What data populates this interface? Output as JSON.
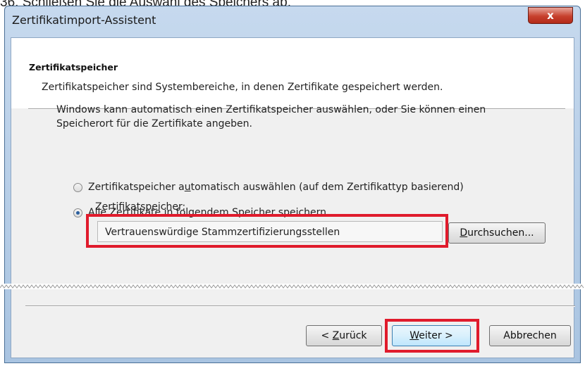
{
  "caption": "36. Schließen Sie die Auswahl des Speichers ab.",
  "window": {
    "title": "Zertifikatimport-Assistent",
    "close_glyph": "x"
  },
  "header": {
    "title": "Zertifikatspeicher",
    "description": "Zertifikatspeicher sind Systembereiche, in denen Zertifikate gespeichert werden."
  },
  "body": {
    "intro": "Windows kann automatisch einen Zertifikatspeicher auswählen, oder Sie können einen Speicherort für die Zertifikate angeben.",
    "options": [
      {
        "pre": "Zertifikatspeicher a",
        "accel": "u",
        "post": "tomatisch auswählen (auf dem Zertifikattyp basierend)",
        "checked": false
      },
      {
        "pre": "",
        "accel": "A",
        "post": "lle Zertifikate in folgendem Speicher speichern",
        "checked": true
      }
    ],
    "store_label": "Zertifikatspeicher:",
    "store_value": "Vertrauenswürdige Stammzertifizierungsstellen",
    "browse": {
      "accel": "D",
      "rest": "urchsuchen..."
    }
  },
  "footer": {
    "back": {
      "prefix": "< ",
      "accel": "Z",
      "rest": "urück"
    },
    "next": {
      "accel": "W",
      "rest": "eiter >"
    },
    "cancel": "Abbrechen"
  },
  "colors": {
    "highlight": "#e01b2c",
    "title_bar": "#b9cfe8",
    "close_button": "#c7402d"
  }
}
